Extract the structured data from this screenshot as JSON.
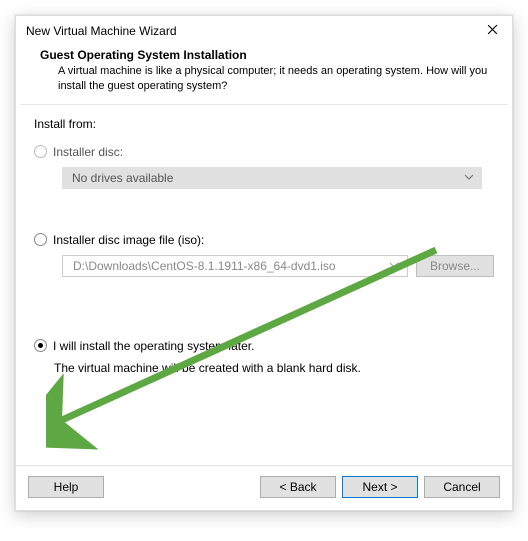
{
  "titlebar": {
    "title": "New Virtual Machine Wizard"
  },
  "header": {
    "title": "Guest Operating System Installation",
    "desc": "A virtual machine is like a physical computer; it needs an operating system. How will you install the guest operating system?"
  },
  "content": {
    "install_from_label": "Install from:",
    "opt_disc_label": "Installer disc:",
    "disc_combo_text": "No drives available",
    "opt_iso_label": "Installer disc image file (iso):",
    "iso_path": "D:\\Downloads\\CentOS-8.1.1911-x86_64-dvd1.iso",
    "browse_label": "Browse...",
    "opt_later_label": "I will install the operating system later.",
    "later_desc": "The virtual machine will be created with a blank hard disk."
  },
  "footer": {
    "help": "Help",
    "back": "< Back",
    "next": "Next >",
    "cancel": "Cancel"
  },
  "colors": {
    "arrow": "#5da843"
  }
}
